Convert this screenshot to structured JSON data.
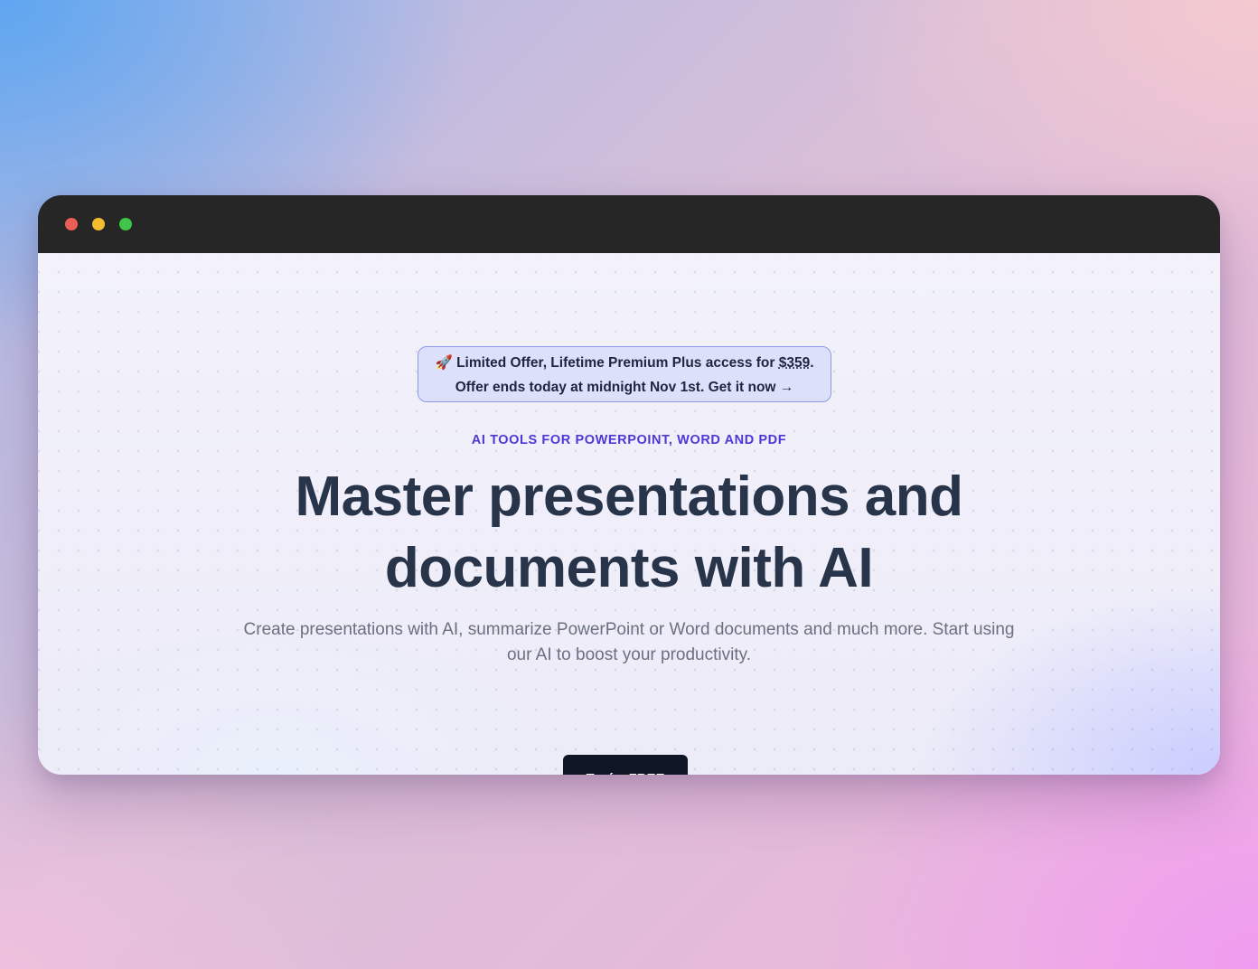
{
  "window": {
    "controls": [
      "close",
      "minimize",
      "maximize"
    ]
  },
  "banner": {
    "icon": "rocket-icon",
    "emoji": "🚀",
    "line1_prefix": "Limited Offer, Lifetime Premium Plus access for ",
    "price": "$359",
    "line1_suffix": ".",
    "line2": "Offer ends today at midnight Nov 1st. Get it now →"
  },
  "hero": {
    "kicker": "AI TOOLS FOR POWERPOINT, WORD AND PDF",
    "headline_line1": "Master presentations and",
    "headline_line2": "documents with AI",
    "subtitle_line1": "Create presentations with AI, summarize PowerPoint or Word documents and much more. Start using",
    "subtitle_line2": "our AI to boost your productivity.",
    "cta_label": "Try for FREE"
  },
  "colors": {
    "accent": "#4b39d6",
    "headline": "#273449",
    "cta_bg": "#0e1525",
    "titlebar": "#262626"
  }
}
